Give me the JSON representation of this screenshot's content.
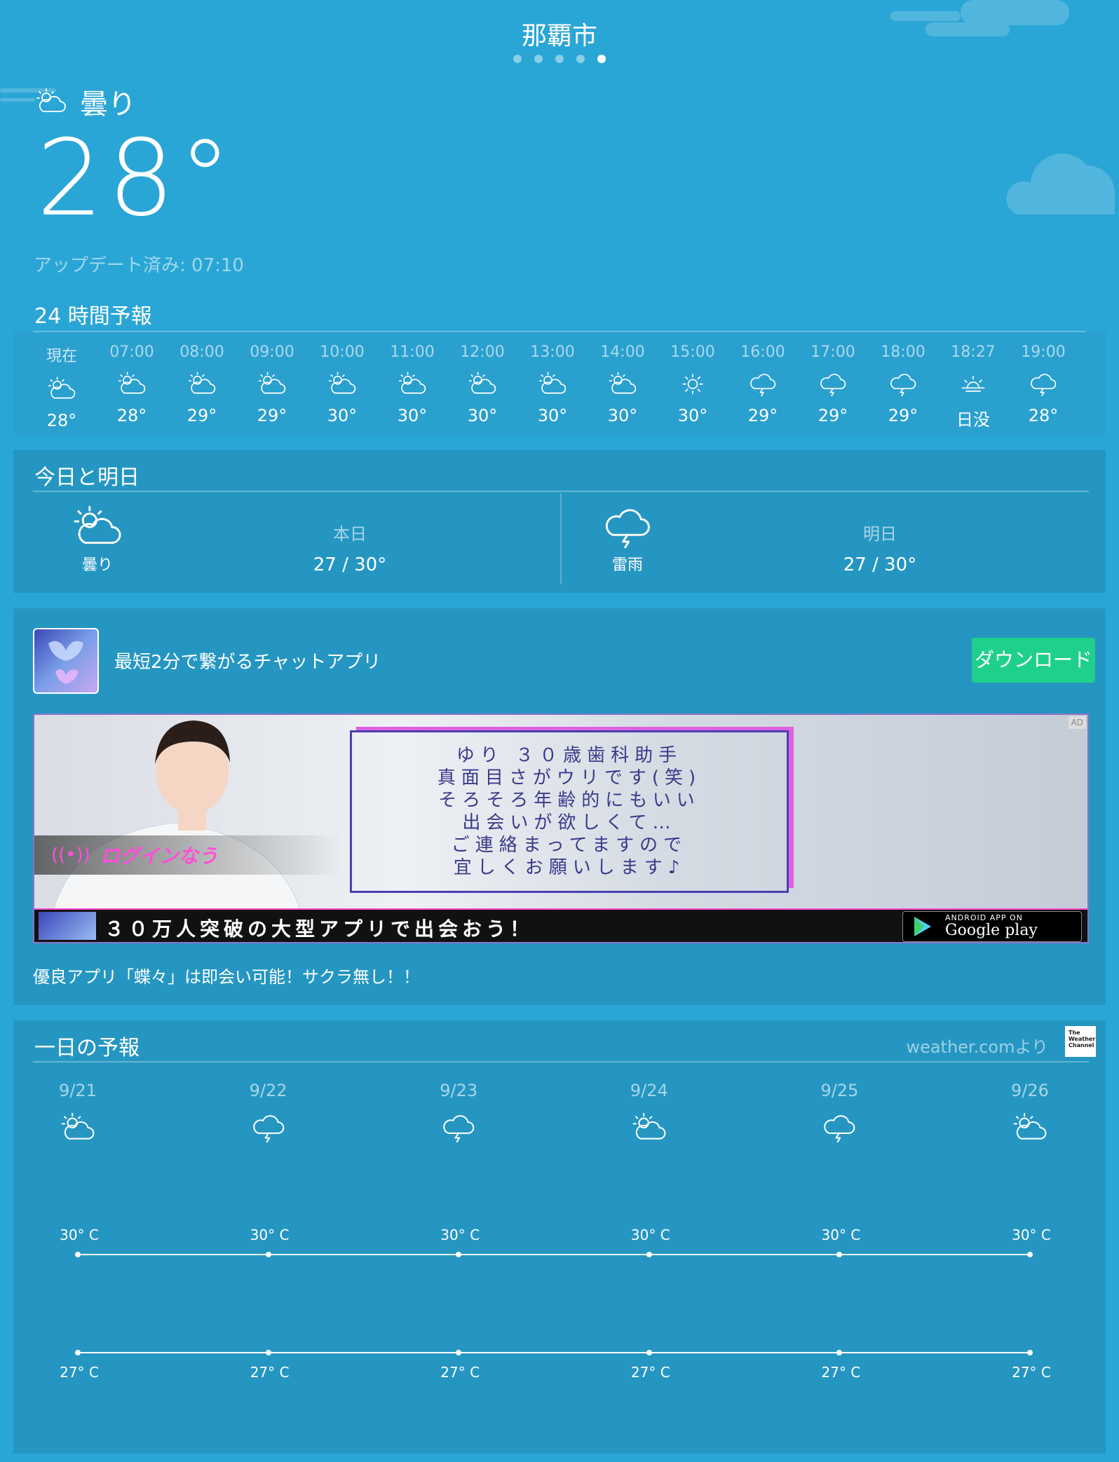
{
  "header": {
    "city": "那覇市",
    "page_dots": 5,
    "active_dot": 4
  },
  "current": {
    "condition": "曇り",
    "condition_icon": "partly-cloudy-icon",
    "temperature": "28°",
    "updated_label": "アップデート済み: 07:10"
  },
  "hourly": {
    "title": "24 時間予報",
    "items": [
      {
        "time": "現在",
        "icon": "partly-cloudy-icon",
        "temp": "28°"
      },
      {
        "time": "07:00",
        "icon": "partly-cloudy-icon",
        "temp": "28°"
      },
      {
        "time": "08:00",
        "icon": "partly-cloudy-icon",
        "temp": "29°"
      },
      {
        "time": "09:00",
        "icon": "partly-cloudy-icon",
        "temp": "29°"
      },
      {
        "time": "10:00",
        "icon": "partly-cloudy-icon",
        "temp": "30°"
      },
      {
        "time": "11:00",
        "icon": "partly-cloudy-icon",
        "temp": "30°"
      },
      {
        "time": "12:00",
        "icon": "partly-cloudy-icon",
        "temp": "30°"
      },
      {
        "time": "13:00",
        "icon": "partly-cloudy-icon",
        "temp": "30°"
      },
      {
        "time": "14:00",
        "icon": "partly-cloudy-icon",
        "temp": "30°"
      },
      {
        "time": "15:00",
        "icon": "sunny-icon",
        "temp": "30°"
      },
      {
        "time": "16:00",
        "icon": "thunderstorm-icon",
        "temp": "29°"
      },
      {
        "time": "17:00",
        "icon": "thunderstorm-icon",
        "temp": "29°"
      },
      {
        "time": "18:00",
        "icon": "thunderstorm-icon",
        "temp": "29°"
      },
      {
        "time": "18:27",
        "icon": "sunset-icon",
        "temp": "日没"
      },
      {
        "time": "19:00",
        "icon": "thunderstorm-icon",
        "temp": "28°"
      }
    ]
  },
  "today_tomorrow": {
    "title": "今日と明日",
    "today": {
      "label": "本日",
      "condition": "曇り",
      "icon": "partly-cloudy-icon",
      "range": "27 / 30°"
    },
    "tomorrow": {
      "label": "明日",
      "condition": "雷雨",
      "icon": "thunderstorm-icon",
      "range": "27 / 30°"
    }
  },
  "ad": {
    "headline": "最短2分で繋がるチャットアプリ",
    "button": "ダウンロード",
    "ad_tag": "AD",
    "banner_message": [
      "ゆり ３０歳歯科助手",
      "真面目さがウリです(笑)",
      "そろそろ年齢的にもいい",
      "出会いが欲しくて…",
      "ご連絡まってますので",
      "宜しくお願いします♪"
    ],
    "banner_login": "ログインなう",
    "banner_bottom": "３０万人突破の大型アプリで出会おう！",
    "store_line1": "ANDROID APP ON",
    "store_line2": "Google play",
    "description": "優良アプリ「蝶々」は即会い可能！サクラ無し！！"
  },
  "daily": {
    "title": "一日の予報",
    "source": "weather.comより",
    "source_logo": "The Weather Channel",
    "days": [
      {
        "date": "9/21",
        "icon": "partly-cloudy-icon",
        "high": "30° C",
        "low": "27° C"
      },
      {
        "date": "9/22",
        "icon": "thunderstorm-icon",
        "high": "30° C",
        "low": "27° C"
      },
      {
        "date": "9/23",
        "icon": "thunderstorm-icon",
        "high": "30° C",
        "low": "27° C"
      },
      {
        "date": "9/24",
        "icon": "partly-cloudy-icon",
        "high": "30° C",
        "low": "27° C"
      },
      {
        "date": "9/25",
        "icon": "thunderstorm-icon",
        "high": "30° C",
        "low": "27° C"
      },
      {
        "date": "9/26",
        "icon": "partly-cloudy-icon",
        "high": "30° C",
        "low": "27° C"
      }
    ]
  },
  "colors": {
    "background": "#2aa6d6",
    "panel": "#2596c2",
    "download_button": "#1fd08c"
  }
}
